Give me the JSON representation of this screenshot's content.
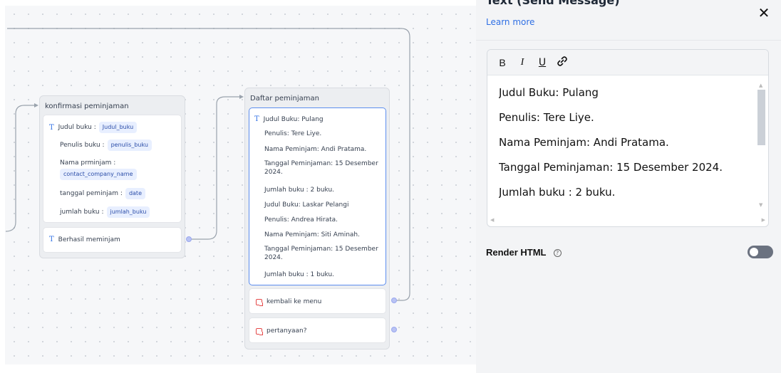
{
  "canvas": {
    "node_konfirmasi": {
      "title": "konfirmasi peminjaman",
      "fields": [
        {
          "label": "Judul buku :",
          "chip": "Judul_buku"
        },
        {
          "label": "Penulis buku :",
          "chip": "penulis_buku"
        },
        {
          "label": "Nama prminjam :",
          "chip": "contact_company_name"
        },
        {
          "label": "tanggal peminjam :",
          "chip": "date"
        },
        {
          "label": "jumlah buku :",
          "chip": "jumlah_buku"
        }
      ],
      "second_block": "Berhasil meminjam"
    },
    "node_daftar": {
      "title": "Daftar peminjaman",
      "lines": [
        "Judul Buku: Pulang",
        "Penulis: Tere Liye.",
        "Nama Peminjam: Andi Pratama.",
        "Tanggal Peminjaman: 15 Desember 2024.",
        "Jumlah buku : 2 buku.",
        "Judul Buku: Laskar Pelangi",
        "Penulis: Andrea Hirata.",
        "Nama Peminjam: Siti Aminah.",
        "Tanggal Peminjaman: 15 Desember 2024.",
        "Jumlah buku : 1 buku."
      ],
      "buttons": [
        "kembali ke menu",
        "pertanyaan?"
      ]
    }
  },
  "panel": {
    "title": "Text (Send Message)",
    "learn_more": "Learn more",
    "close": "✕",
    "toolbar": {
      "bold": "B",
      "italic": "I",
      "underline": "U",
      "link": "🔗"
    },
    "editor_lines": [
      "Judul Buku: Pulang",
      "Penulis: Tere Liye.",
      "Nama Peminjam: Andi Pratama.",
      "Tanggal Peminjaman: 15 Desember 2024.",
      "Jumlah buku : 2 buku."
    ],
    "render_html_label": "Render HTML",
    "render_html_enabled": false
  },
  "colors": {
    "accent": "#2f6fe4",
    "chip_bg": "#e8efff",
    "message_icon": "#e54848",
    "toggle_off": "#6b7280"
  }
}
